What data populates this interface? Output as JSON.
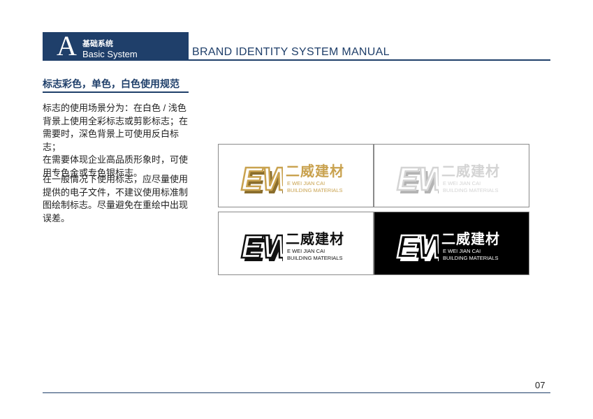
{
  "section": {
    "letter": "A",
    "cn": "基础系统",
    "en": "Basic System"
  },
  "manual_title": "BRAND IDENTITY SYSTEM MANUAL",
  "subtitle": "标志彩色，单色，白色使用规范",
  "paragraph1": [
    "标志的使用场景分为：在白色 / 浅色",
    "背景上使用全彩标志或剪影标志；在",
    "需要时，深色背景上可使用反白标志；",
    "在需要体现企业高品质形象时，可使",
    "用专色金或专色银标志。"
  ],
  "paragraph2": [
    "在一般情况下使用标志，应尽量使用",
    "提供的电子文件，不建议使用标准制",
    "图绘制标志。尽量避免在重绘中出现",
    "误差。"
  ],
  "logo": {
    "name_cn": "二威建材",
    "name_en1": "E WEI JIAN CAI",
    "name_en2": "BUILDING MATERIALS",
    "mark_letters": "EW"
  },
  "panels": [
    {
      "variant": "gold",
      "background": "#ffffff",
      "color": "#c9a24f",
      "shade": "#8a6d2c"
    },
    {
      "variant": "silver",
      "background": "#ffffff",
      "color": "#d4d4d4",
      "shade": "#b3b3b3"
    },
    {
      "variant": "black",
      "background": "#ffffff",
      "color": "#111111",
      "shade": "#111111"
    },
    {
      "variant": "reverse-white",
      "background": "#000000",
      "color": "#ffffff",
      "shade": "#ffffff"
    }
  ],
  "colors": {
    "brand_blue": "#1f3f6a"
  },
  "page_number": "07"
}
